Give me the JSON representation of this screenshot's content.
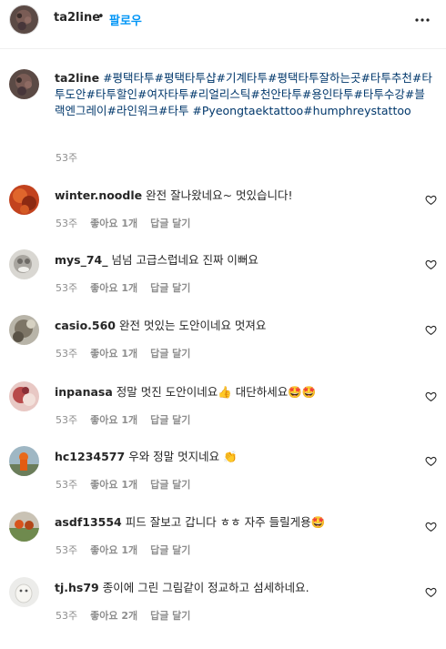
{
  "header": {
    "username": "ta2line",
    "dot": "•",
    "follow_label": "팔로우"
  },
  "caption": {
    "username": "ta2line",
    "text": "#평택타투#평택타투샵#기계타투#평택타투잘하는곳#타투추천#타투도안#타투할인#여자타투#리얼리스틱#천안타투#용인타투#타투수강#블랙엔그레이#라인워크#타투 #Pyeongtaektattoo#humphreystattoo",
    "time": "53주"
  },
  "comments": [
    {
      "username": "winter.noodle",
      "text": "완전 잘나왔네요~ 멋있습니다!",
      "time": "53주",
      "likes": "좋아요 1개",
      "reply": "답글 달기"
    },
    {
      "username": "mys_74_",
      "text": "넘넘 고급스럽네요 진짜 이뻐요",
      "time": "53주",
      "likes": "좋아요 1개",
      "reply": "답글 달기"
    },
    {
      "username": "casio.560",
      "text": "완전 멋있는 도안이네요 멋져요",
      "time": "53주",
      "likes": "좋아요 1개",
      "reply": "답글 달기"
    },
    {
      "username": "inpanasa",
      "text": "정말 멋진 도안이네요👍 대단하세요🤩🤩",
      "time": "53주",
      "likes": "좋아요 1개",
      "reply": "답글 달기"
    },
    {
      "username": "hc1234577",
      "text": "우와 정말 멋지네요 👏",
      "time": "53주",
      "likes": "좋아요 1개",
      "reply": "답글 달기"
    },
    {
      "username": "asdf13554",
      "text": "피드 잘보고 갑니다 ㅎㅎ 자주 들릴게용🤩",
      "time": "53주",
      "likes": "좋아요 1개",
      "reply": "답글 달기"
    },
    {
      "username": "tj.hs79",
      "text": "종이에 그린 그림같이 정교하고 섬세하네요.",
      "time": "53주",
      "likes": "좋아요 2개",
      "reply": "답글 달기"
    }
  ],
  "icons": {
    "more": "more-options-icon",
    "heart": "heart-outline-icon"
  },
  "colors": {
    "follow": "#0095f6",
    "hashtag": "#00376b",
    "secondary_text": "#8e8e8e",
    "primary_text": "#262626"
  }
}
